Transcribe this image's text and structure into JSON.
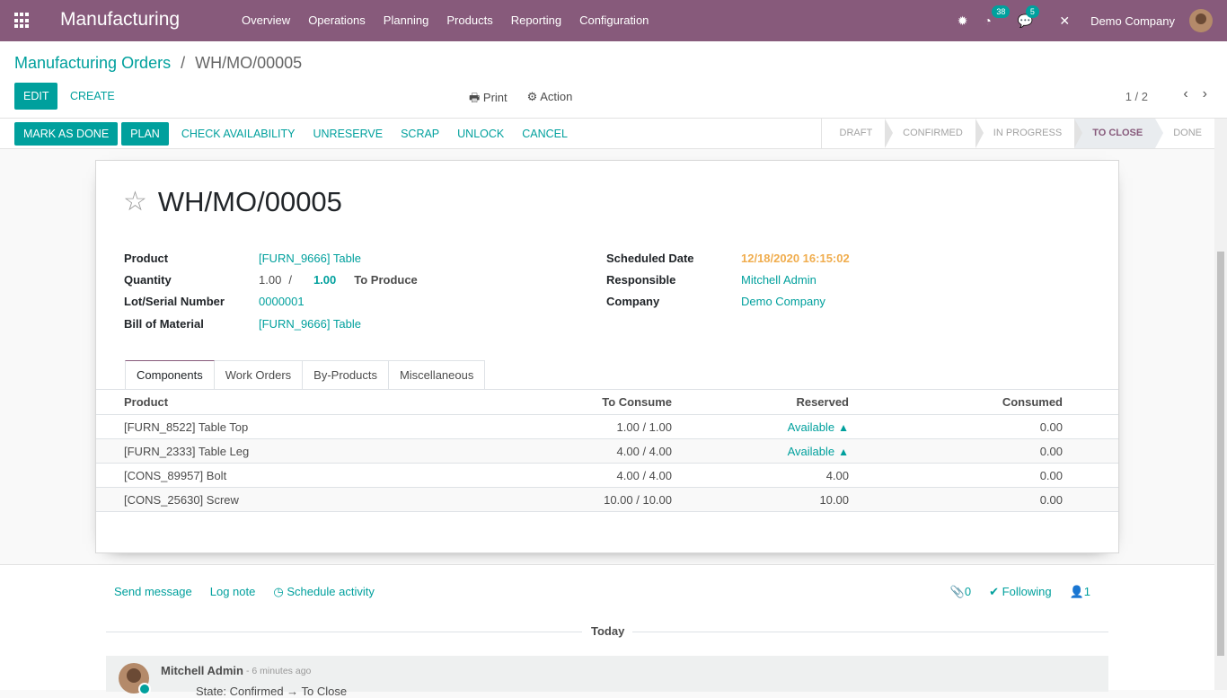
{
  "navbar": {
    "app_name": "Manufacturing",
    "menu": [
      "Overview",
      "Operations",
      "Planning",
      "Products",
      "Reporting",
      "Configuration"
    ],
    "activity_count": "38",
    "message_count": "5",
    "company": "Demo Company"
  },
  "breadcrumb": {
    "parent": "Manufacturing Orders",
    "separator": "/",
    "current": "WH/MO/00005"
  },
  "toolbar": {
    "edit_label": "EDIT",
    "create_label": "CREATE",
    "print_label": "Print",
    "action_label": "Action",
    "pager": "1 / 2"
  },
  "statusbar": {
    "buttons": {
      "mark_done": "MARK AS DONE",
      "plan": "PLAN",
      "check_availability": "CHECK AVAILABILITY",
      "unreserve": "UNRESERVE",
      "scrap": "SCRAP",
      "unlock": "UNLOCK",
      "cancel": "CANCEL"
    },
    "stages": [
      "DRAFT",
      "CONFIRMED",
      "IN PROGRESS",
      "TO CLOSE",
      "DONE"
    ],
    "active_stage": "TO CLOSE"
  },
  "form": {
    "title": "WH/MO/00005",
    "product_label": "Product",
    "product_value": "[FURN_9666] Table",
    "quantity_label": "Quantity",
    "quantity_produced": "1.00",
    "quantity_sep": "/",
    "quantity_target": "1.00",
    "to_produce_label": "To Produce",
    "lot_label": "Lot/Serial Number",
    "lot_value": "0000001",
    "bom_label": "Bill of Material",
    "bom_value": "[FURN_9666] Table",
    "scheduled_label": "Scheduled Date",
    "scheduled_value": "12/18/2020 16:15:02",
    "responsible_label": "Responsible",
    "responsible_value": "Mitchell Admin",
    "company_label": "Company",
    "company_value": "Demo Company"
  },
  "tabs": [
    "Components",
    "Work Orders",
    "By-Products",
    "Miscellaneous"
  ],
  "components": {
    "headers": {
      "product": "Product",
      "to_consume": "To Consume",
      "reserved": "Reserved",
      "consumed": "Consumed"
    },
    "rows": [
      {
        "product": "[FURN_8522] Table Top",
        "to_consume": "1.00 / 1.00",
        "reserved": "Available",
        "consumed": "0.00"
      },
      {
        "product": "[FURN_2333] Table Leg",
        "to_consume": "4.00 / 4.00",
        "reserved": "Available",
        "consumed": "0.00"
      },
      {
        "product": "[CONS_89957] Bolt",
        "to_consume": "4.00 / 4.00",
        "reserved": "4.00",
        "consumed": "0.00"
      },
      {
        "product": "[CONS_25630] Screw",
        "to_consume": "10.00 / 10.00",
        "reserved": "10.00",
        "consumed": "0.00"
      }
    ]
  },
  "chatter": {
    "send_message": "Send message",
    "log_note": "Log note",
    "schedule_activity": "Schedule activity",
    "attachments": "0",
    "following": "Following",
    "followers": "1",
    "today": "Today",
    "author": "Mitchell Admin",
    "time": "- 6 minutes ago",
    "body": "State: Confirmed → To Close"
  },
  "icons": {
    "apps": "apps-grid-icon",
    "bug": "bug-icon",
    "activity": "clock-icon",
    "messages": "chat-icon",
    "tools": "tools-icon",
    "print": "print-icon",
    "action": "gear-icon",
    "star": "star-icon"
  },
  "colors": {
    "navbar": "#875a7b",
    "accent": "#00a09d",
    "date": "#f0ad4e"
  }
}
